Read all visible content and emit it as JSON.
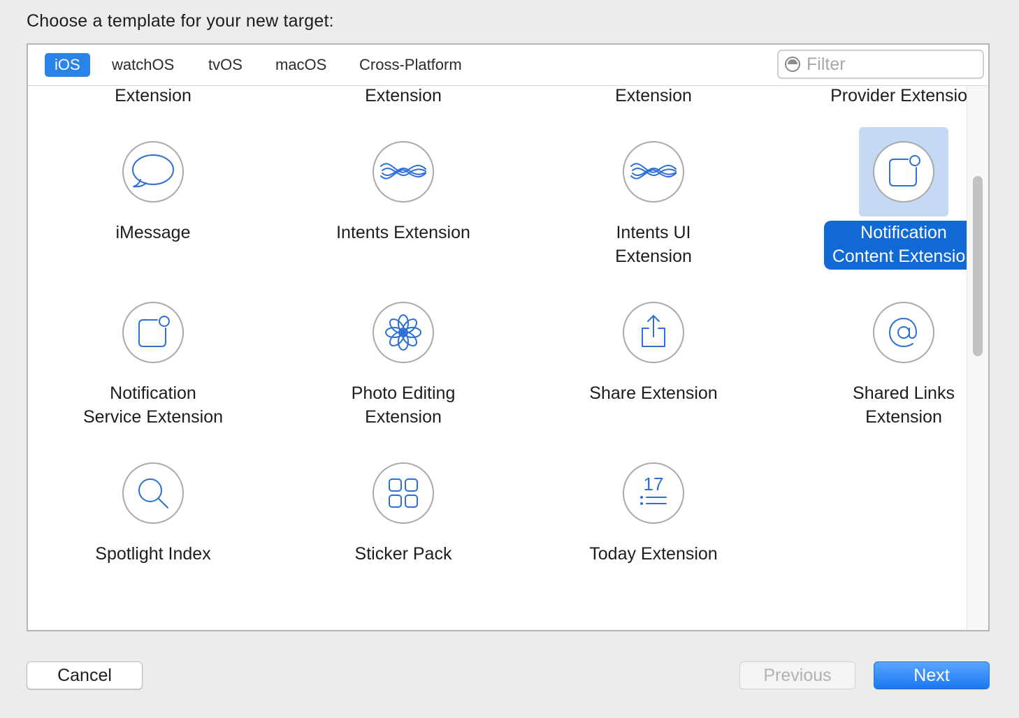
{
  "heading": "Choose a template for your new target:",
  "tabs": [
    {
      "label": "iOS",
      "selected": true
    },
    {
      "label": "watchOS",
      "selected": false
    },
    {
      "label": "tvOS",
      "selected": false
    },
    {
      "label": "macOS",
      "selected": false
    },
    {
      "label": "Cross-Platform",
      "selected": false
    }
  ],
  "filter": {
    "placeholder": "Filter",
    "value": "",
    "icon": "filter-icon"
  },
  "templates": [
    {
      "label": "Call Directory\nExtension",
      "icon": "phone-icon",
      "selected": false
    },
    {
      "label": "Content Blocker\nExtension",
      "icon": "shield-icon",
      "selected": false
    },
    {
      "label": "Custom Keyboard\nExtension",
      "icon": "keyboard-icon",
      "selected": false
    },
    {
      "label": "Document\nProvider Extension",
      "icon": "cloud-icon",
      "selected": false
    },
    {
      "label": "iMessage",
      "icon": "speech-bubble-icon",
      "selected": false
    },
    {
      "label": "Intents Extension",
      "icon": "intents-wave-icon",
      "selected": false
    },
    {
      "label": "Intents UI\nExtension",
      "icon": "intents-wave-icon",
      "selected": false
    },
    {
      "label": "Notification\nContent Extension",
      "icon": "notification-badge-icon",
      "selected": true
    },
    {
      "label": "Notification\nService Extension",
      "icon": "notification-badge-icon",
      "selected": false
    },
    {
      "label": "Photo Editing\nExtension",
      "icon": "flower-icon",
      "selected": false
    },
    {
      "label": "Share Extension",
      "icon": "share-icon",
      "selected": false
    },
    {
      "label": "Shared Links\nExtension",
      "icon": "at-sign-icon",
      "selected": false
    },
    {
      "label": "Spotlight Index",
      "icon": "magnifier-icon",
      "selected": false
    },
    {
      "label": "Sticker Pack",
      "icon": "grid-squares-icon",
      "selected": false
    },
    {
      "label": "Today Extension",
      "icon": "calendar-list-icon",
      "selected": false
    }
  ],
  "today_icon_date": "17",
  "buttons": {
    "cancel": "Cancel",
    "previous": "Previous",
    "next": "Next",
    "previous_enabled": false
  },
  "colors": {
    "accent": "#2a83e8",
    "selected_label": "#1069d4",
    "icon_stroke": "#2d6fd8",
    "selection_bg": "#c3d9f4"
  }
}
